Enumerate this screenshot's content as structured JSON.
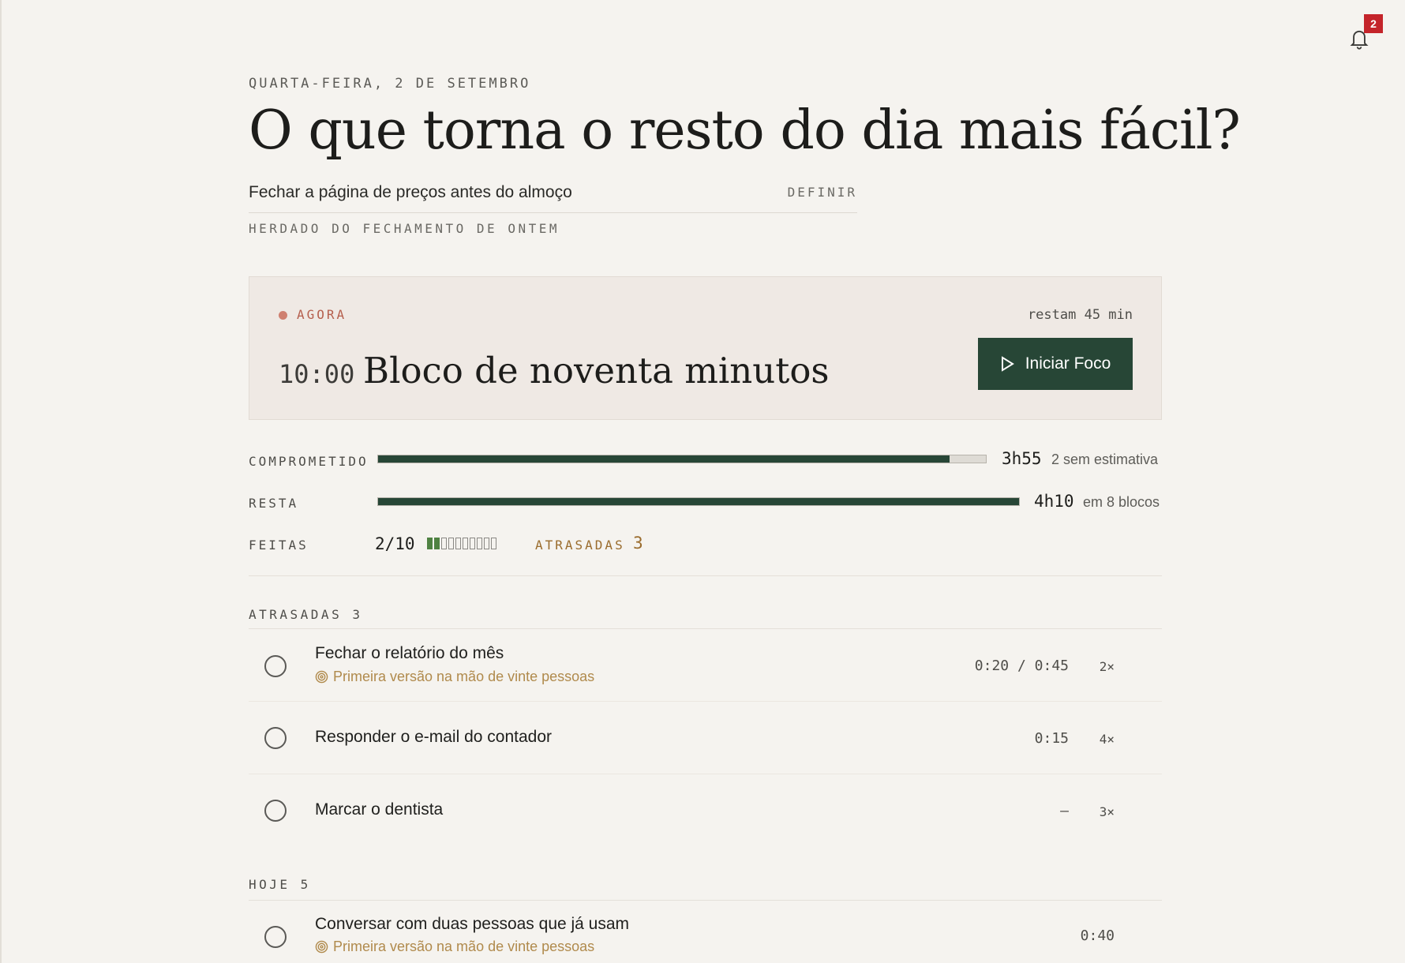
{
  "notifications": {
    "count": "2"
  },
  "header": {
    "date": "QUARTA-FEIRA, 2 DE SETEMBRO",
    "headline": "O que torna o resto do dia mais fácil?",
    "intent": "Fechar a página de preços antes do almoço",
    "define_label": "DEFINIR",
    "inherited_note": "HERDADO DO FECHAMENTO DE ONTEM"
  },
  "now": {
    "label": "AGORA",
    "remaining": "restam 45 min",
    "time": "10:00",
    "title": "Bloco de noventa minutos",
    "button_label": "Iniciar Foco"
  },
  "metrics": {
    "committed": {
      "label": "COMPROMETIDO",
      "value": "3h55",
      "note": "2 sem estimativa",
      "fill_fraction": 0.94
    },
    "remaining": {
      "label": "RESTA",
      "value": "4h10",
      "note": "em 8 blocos",
      "fill_fraction": 1.0
    },
    "done": {
      "label": "FEITAS",
      "value": "2/10",
      "done_count": 2,
      "total_count": 10,
      "late_label": "ATRASADAS",
      "late_count": "3"
    }
  },
  "sections": {
    "late": {
      "label": "ATRASADAS",
      "count": "3"
    },
    "today": {
      "label": "HOJE",
      "count": "5"
    }
  },
  "tasks": {
    "late": [
      {
        "title": "Fechar o relatório do mês",
        "subtitle": "Primeira versão na mão de vinte pessoas",
        "time": "0:20 / 0:45",
        "mult": "2×"
      },
      {
        "title": "Responder o e-mail do contador",
        "time": "0:15",
        "mult": "4×"
      },
      {
        "title": "Marcar o dentista",
        "time": "–",
        "mult": "3×"
      }
    ],
    "today": [
      {
        "title": "Conversar com duas pessoas que já usam",
        "subtitle": "Primeira versão na mão de vinte pessoas",
        "time": "0:40"
      }
    ]
  },
  "colors": {
    "accent": "#274636",
    "late": "#9a6c2d",
    "now_dot": "#cf8070",
    "badge": "#c4242a"
  }
}
